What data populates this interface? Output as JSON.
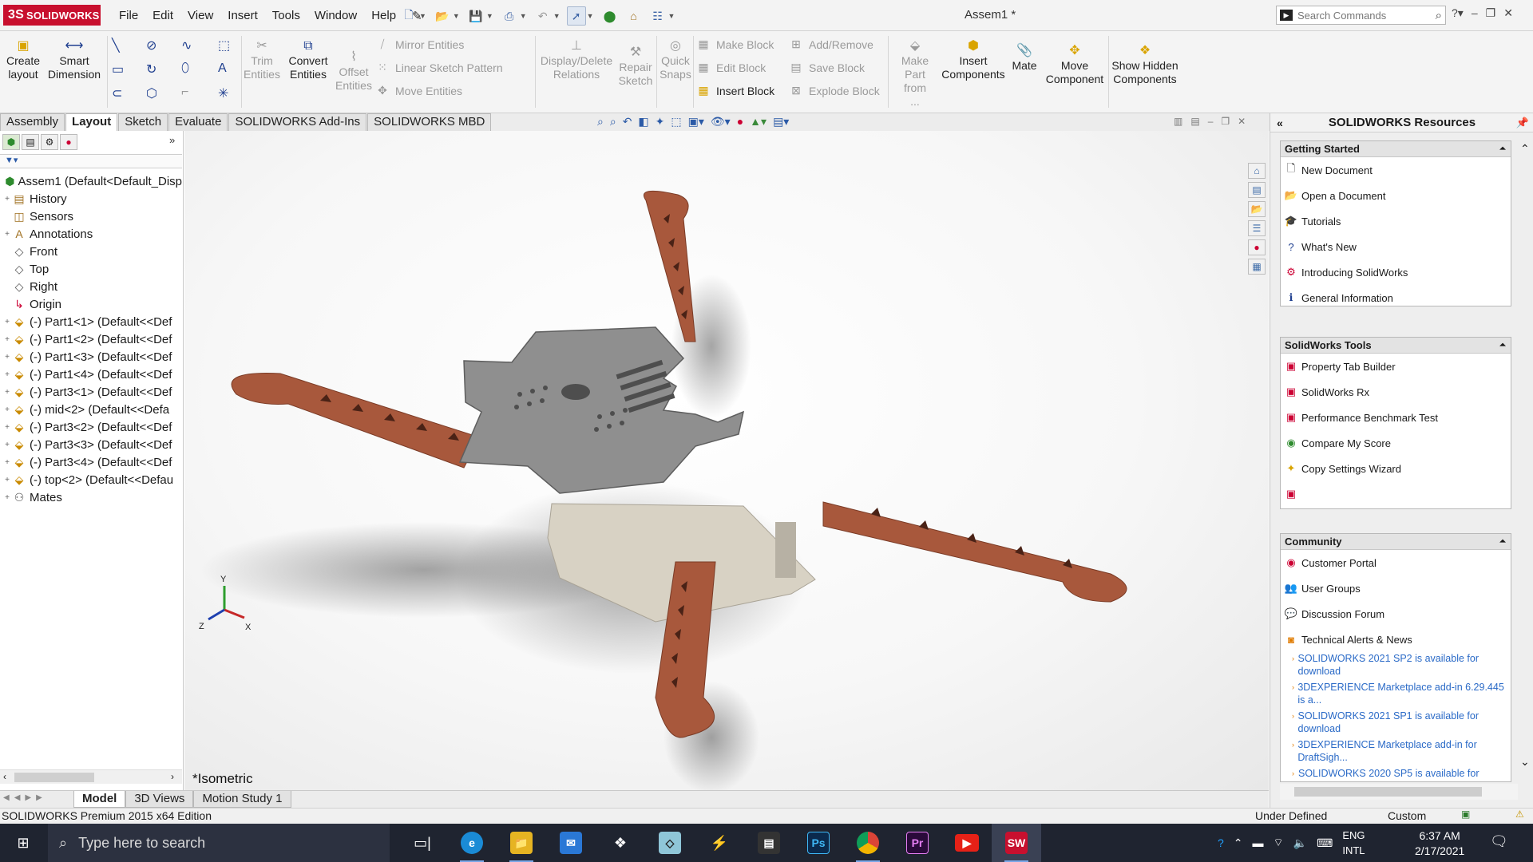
{
  "app": {
    "logo_text": "SOLIDWORKS",
    "logo_mark": "3S",
    "doc_title": "Assem1 *"
  },
  "menu": [
    "File",
    "Edit",
    "View",
    "Insert",
    "Tools",
    "Window",
    "Help"
  ],
  "search": {
    "placeholder": "Search Commands"
  },
  "cmd": {
    "create_layout": "Create layout",
    "smart_dimension": "Smart Dimension",
    "trim": "Trim Entities",
    "convert": "Convert Entities",
    "offset": "Offset Entities",
    "mirror": "Mirror Entities",
    "linear": "Linear Sketch Pattern",
    "move_entities": "Move Entities",
    "display_relations": "Display/Delete Relations",
    "repair": "Repair Sketch",
    "quick_snaps": "Quick Snaps",
    "make_block": "Make Block",
    "edit_block": "Edit Block",
    "insert_block": "Insert Block",
    "add_remove": "Add/Remove",
    "save_block": "Save Block",
    "explode_block": "Explode Block",
    "make_part": "Make Part from ...",
    "insert_components": "Insert Components",
    "mate": "Mate",
    "move_component": "Move Component",
    "show_hidden": "Show Hidden Components"
  },
  "cm_tabs": [
    "Assembly",
    "Layout",
    "Sketch",
    "Evaluate",
    "SOLIDWORKS Add-Ins",
    "SOLIDWORKS MBD"
  ],
  "cm_active_tab": "Layout",
  "tree": [
    {
      "label": "Assem1  (Default<Default_Disp",
      "icon": "assembly-icon",
      "exp": ""
    },
    {
      "label": "History",
      "icon": "history-icon",
      "exp": "+"
    },
    {
      "label": "Sensors",
      "icon": "sensors-icon",
      "exp": ""
    },
    {
      "label": "Annotations",
      "icon": "annotations-icon",
      "exp": "+"
    },
    {
      "label": "Front",
      "icon": "plane-icon",
      "exp": ""
    },
    {
      "label": "Top",
      "icon": "plane-icon",
      "exp": ""
    },
    {
      "label": "Right",
      "icon": "plane-icon",
      "exp": ""
    },
    {
      "label": "Origin",
      "icon": "origin-icon",
      "exp": ""
    },
    {
      "label": "(-) Part1<1> (Default<<Def",
      "icon": "part-icon",
      "exp": "+"
    },
    {
      "label": "(-) Part1<2> (Default<<Def",
      "icon": "part-icon",
      "exp": "+"
    },
    {
      "label": "(-) Part1<3> (Default<<Def",
      "icon": "part-icon",
      "exp": "+"
    },
    {
      "label": "(-) Part1<4> (Default<<Def",
      "icon": "part-icon",
      "exp": "+"
    },
    {
      "label": "(-) Part3<1> (Default<<Def",
      "icon": "part-icon",
      "exp": "+"
    },
    {
      "label": "(-) mid<2> (Default<<Defa",
      "icon": "part-icon",
      "exp": "+"
    },
    {
      "label": "(-) Part3<2> (Default<<Def",
      "icon": "part-icon",
      "exp": "+"
    },
    {
      "label": "(-) Part3<3> (Default<<Def",
      "icon": "part-icon",
      "exp": "+"
    },
    {
      "label": "(-) Part3<4> (Default<<Def",
      "icon": "part-icon",
      "exp": "+"
    },
    {
      "label": "(-) top<2> (Default<<Defau",
      "icon": "part-icon",
      "exp": "+"
    },
    {
      "label": "Mates",
      "icon": "mates-icon",
      "exp": "+"
    }
  ],
  "viewport": {
    "view_label": "*Isometric",
    "triad": {
      "x": "X",
      "y": "Y",
      "z": "Z"
    }
  },
  "resources": {
    "title": "SOLIDWORKS Resources",
    "getting_started": {
      "title": "Getting Started",
      "items": [
        "New Document",
        "Open a Document",
        "Tutorials",
        "What's New",
        "Introducing SolidWorks",
        "General Information"
      ]
    },
    "tools": {
      "title": "SolidWorks Tools",
      "items": [
        "Property Tab Builder",
        "SolidWorks Rx",
        "Performance Benchmark Test",
        "Compare My Score",
        "Copy Settings Wizard",
        ""
      ]
    },
    "community": {
      "title": "Community",
      "items": [
        "Customer Portal",
        "User Groups",
        "Discussion Forum",
        "Technical Alerts & News"
      ]
    },
    "news": [
      "SOLIDWORKS 2021 SP2 is available for download",
      "3DEXPERIENCE Marketplace add-in 6.29.445 is a...",
      "SOLIDWORKS 2021 SP1 is available for download",
      "3DEXPERIENCE Marketplace add-in for DraftSigh...",
      "SOLIDWORKS 2020 SP5 is available for"
    ]
  },
  "model_tabs": [
    "Model",
    "3D Views",
    "Motion Study 1"
  ],
  "model_active_tab": "Model",
  "status": {
    "edition": "SOLIDWORKS Premium 2015 x64 Edition",
    "state": "Under Defined",
    "units": "Custom"
  },
  "taskbar": {
    "search_placeholder": "Type here to search",
    "time": "6:37 AM",
    "date": "2/17/2021",
    "lang_top": "ENG",
    "lang_bottom": "INTL"
  },
  "colors": {
    "arm": "#a8583c",
    "plate": "#8e8e8e",
    "lower_plate": "#d6d0c2",
    "accent": "#c8102e"
  }
}
